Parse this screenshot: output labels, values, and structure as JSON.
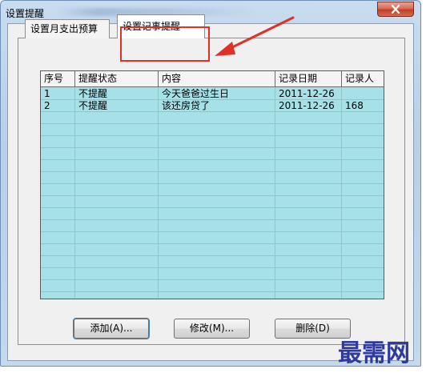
{
  "window": {
    "title": "设置提醒",
    "close_icon": "close-icon"
  },
  "tabs": [
    {
      "label": "设置月支出预算",
      "active": false
    },
    {
      "label": "设置记事提醒",
      "active": true
    }
  ],
  "grid": {
    "columns": [
      "序号",
      "提醒状态",
      "内容",
      "记录日期",
      "记录人"
    ],
    "rows": [
      [
        "1",
        "不提醒",
        "今天爸爸过生日",
        "2011-12-26",
        ""
      ],
      [
        "2",
        "不提醒",
        "该还房贷了",
        "2011-12-26",
        "168"
      ]
    ]
  },
  "buttons": {
    "add": "添加(A)...",
    "edit": "修改(M)...",
    "delete": "删除(D)"
  },
  "watermark": "最需网",
  "colors": {
    "grid_background": "#a6e1e8",
    "annotation_red": "#e0302a",
    "watermark_blue": "#2f3a9e"
  }
}
